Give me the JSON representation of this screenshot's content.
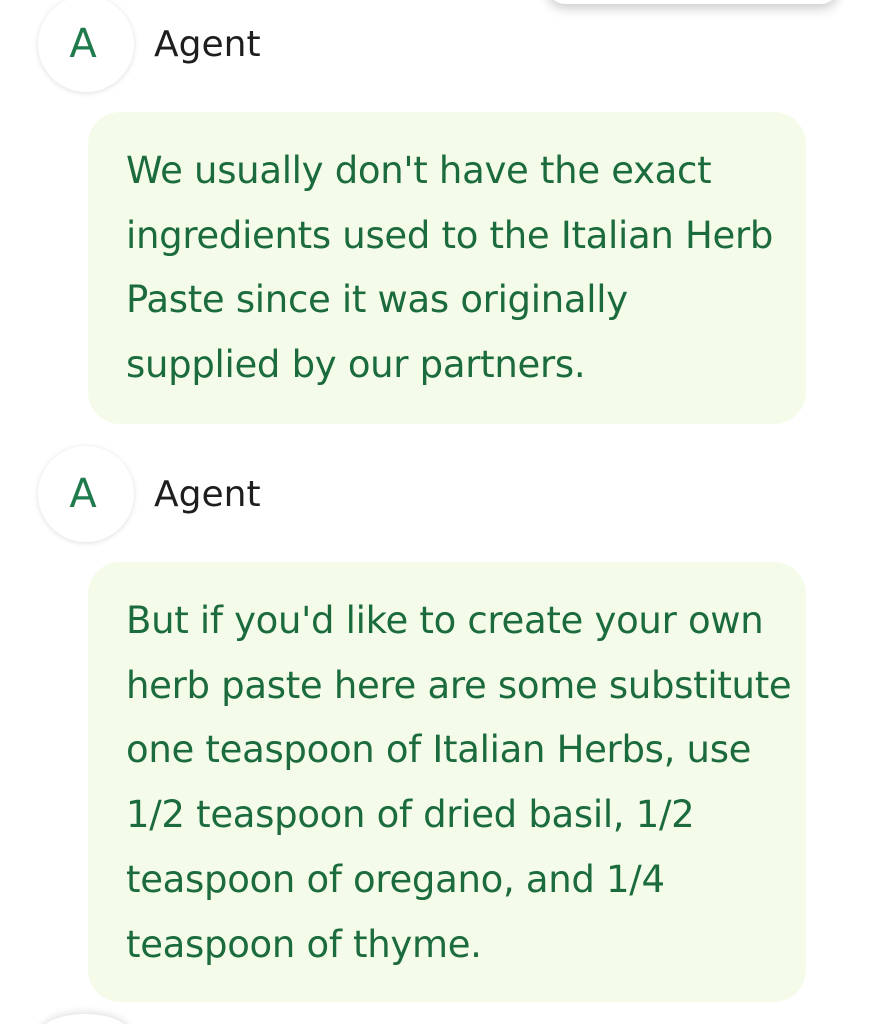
{
  "messages": [
    {
      "avatar_letter": "A",
      "sender": "Agent",
      "lines": [
        "We usually don't have the exact",
        "ingredients used to the Italian Herb",
        "Paste since it was originally",
        "supplied by our partners."
      ]
    },
    {
      "avatar_letter": "A",
      "sender": "Agent",
      "lines": [
        "But if you'd like to create your own",
        "herb paste here are some substitute",
        "one teaspoon of Italian Herbs, use",
        "1/2 teaspoon of dried basil, 1/2",
        "teaspoon of oregano, and 1/4",
        "teaspoon of thyme."
      ]
    }
  ],
  "colors": {
    "bubble_background": "#f4fce9",
    "message_text": "#1b6b3f",
    "avatar_letter": "#1f7a4c",
    "sender_name": "#1e1e1e"
  }
}
